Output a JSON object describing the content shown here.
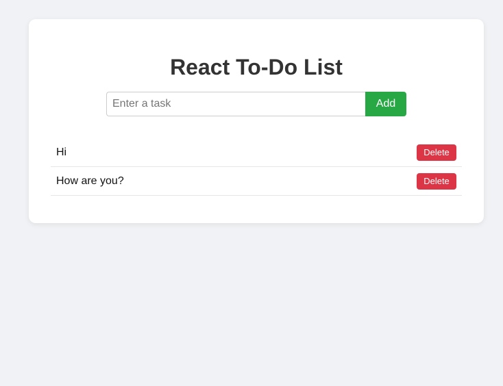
{
  "app": {
    "title": "React To-Do List"
  },
  "input": {
    "value": "",
    "placeholder": "Enter a task"
  },
  "add_button": {
    "label": "Add"
  },
  "todos": [
    {
      "text": "Hi",
      "delete_label": "Delete"
    },
    {
      "text": "How are you?",
      "delete_label": "Delete"
    }
  ],
  "colors": {
    "background": "#f0f2f5",
    "card": "#ffffff",
    "title": "#333333",
    "add_button": "#28a745",
    "delete_button": "#dc3545"
  }
}
